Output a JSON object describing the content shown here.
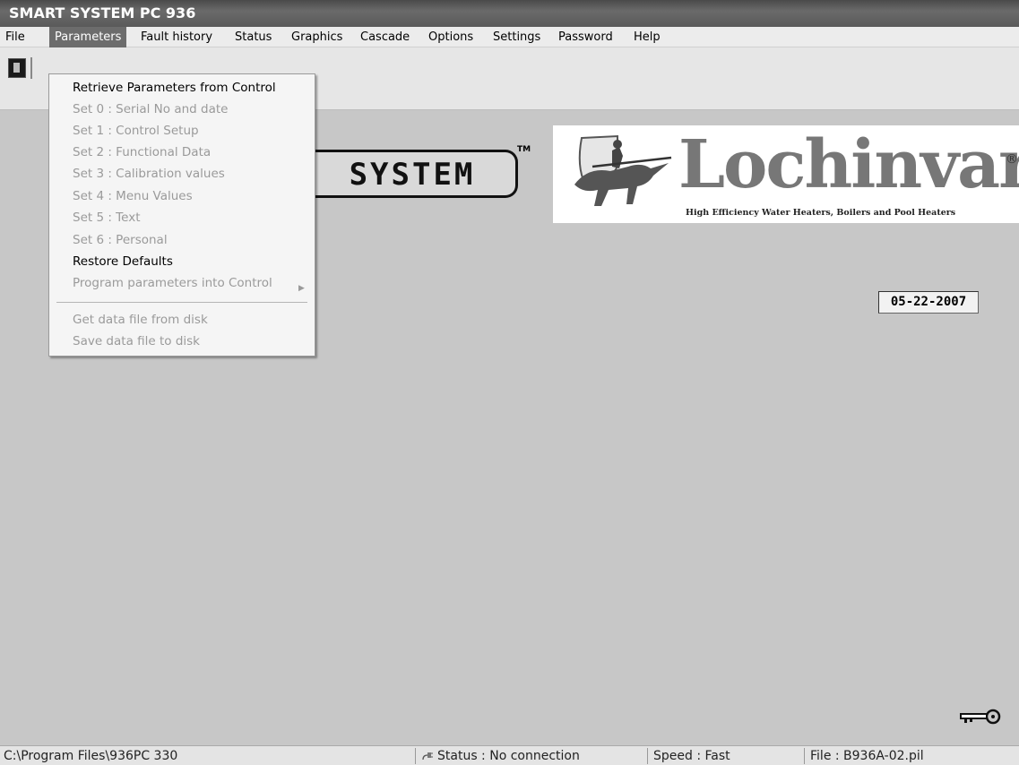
{
  "window": {
    "title": "SMART SYSTEM PC 936"
  },
  "menubar": {
    "items": [
      {
        "label": "File"
      },
      {
        "label": "Parameters"
      },
      {
        "label": "Fault history"
      },
      {
        "label": "Status"
      },
      {
        "label": "Graphics"
      },
      {
        "label": "Cascade"
      },
      {
        "label": "Options"
      },
      {
        "label": "Settings"
      },
      {
        "label": "Password"
      },
      {
        "label": "Help"
      }
    ],
    "active": "Parameters"
  },
  "parameters_menu": {
    "items": [
      {
        "label": "Retrieve Parameters from Control",
        "enabled": true
      },
      {
        "label": "Set 0 : Serial No and date",
        "enabled": false
      },
      {
        "label": "Set 1 : Control Setup",
        "enabled": false
      },
      {
        "label": "Set 2 : Functional Data",
        "enabled": false
      },
      {
        "label": "Set 3 : Calibration values",
        "enabled": false
      },
      {
        "label": "Set 4 : Menu Values",
        "enabled": false
      },
      {
        "label": "Set 5 : Text",
        "enabled": false
      },
      {
        "label": "Set 6 : Personal",
        "enabled": false
      },
      {
        "label": "Restore Defaults",
        "enabled": true
      },
      {
        "label": "Program parameters into Control",
        "enabled": false,
        "submenu": true
      },
      {
        "label": "Get data file from disk",
        "enabled": false
      },
      {
        "label": "Save data file to disk",
        "enabled": false
      }
    ]
  },
  "logos": {
    "smart_system": {
      "text": "SYSTEM",
      "tm": "TM"
    },
    "lochinvar": {
      "name": "Lochinvar",
      "reg": "®",
      "tagline": "High Efficiency Water Heaters, Boilers and Pool Heaters"
    }
  },
  "date": "05-22-2007",
  "statusbar": {
    "path": "C:\\Program Files\\936PC 330",
    "status": "Status : No connection",
    "speed": "Speed : Fast",
    "file": "File : B936A-02.pil"
  },
  "icons": {
    "toolbar": "door-exit-icon",
    "key": "key-icon",
    "plug": "plug-icon"
  }
}
